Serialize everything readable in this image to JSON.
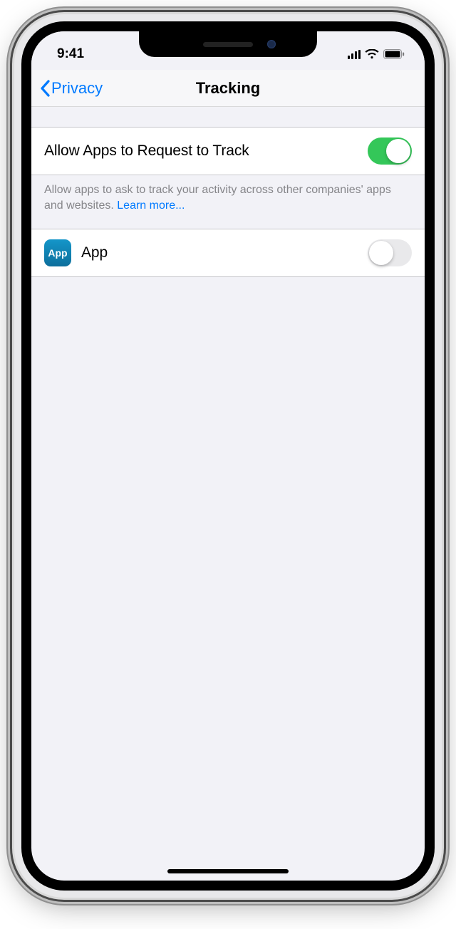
{
  "statusbar": {
    "time": "9:41"
  },
  "nav": {
    "back_label": "Privacy",
    "title": "Tracking"
  },
  "main_toggle": {
    "label": "Allow Apps to Request to Track",
    "on": true
  },
  "footer": {
    "text": "Allow apps to ask to track your activity across other companies' apps and websites. ",
    "link": "Learn more..."
  },
  "apps": [
    {
      "icon_label": "App",
      "name": "App",
      "on": false
    }
  ]
}
